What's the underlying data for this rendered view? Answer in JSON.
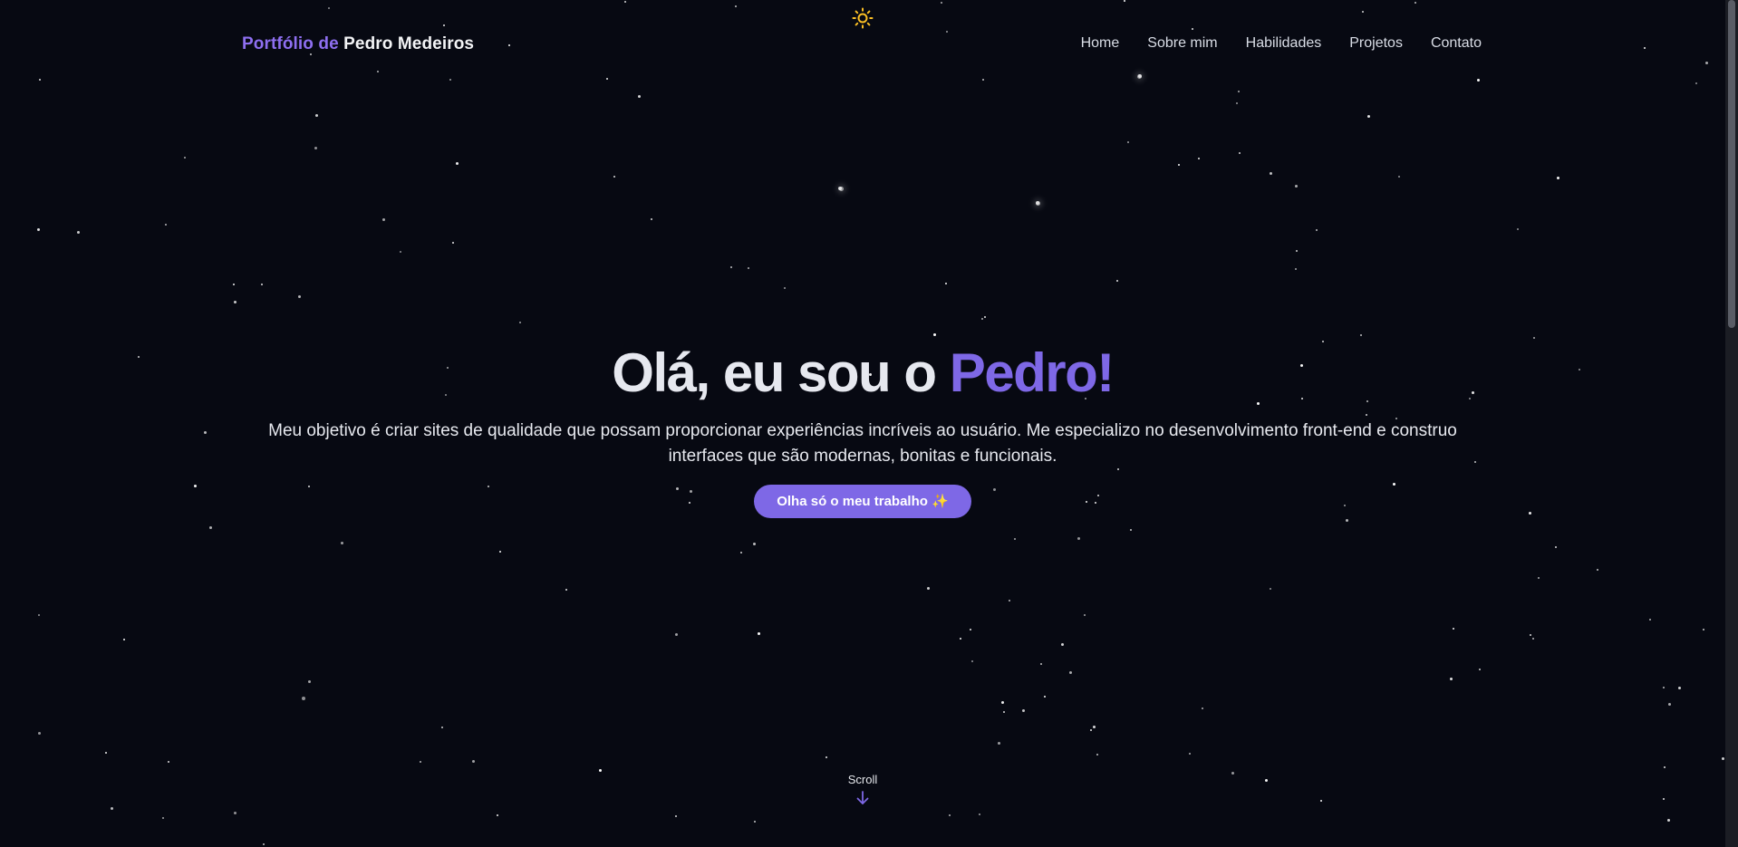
{
  "brand": {
    "prefix": "Portfólio de",
    "name": "Pedro Medeiros"
  },
  "theme_toggle": {
    "icon": "sun-icon",
    "color": "#fbbf24"
  },
  "nav": {
    "items": [
      {
        "label": "Home"
      },
      {
        "label": "Sobre mim"
      },
      {
        "label": "Habilidades"
      },
      {
        "label": "Projetos"
      },
      {
        "label": "Contato"
      }
    ]
  },
  "hero": {
    "title_prefix": "Olá, eu sou o",
    "title_name": "Pedro!",
    "description": "Meu objetivo é criar sites de qualidade que possam proporcionar experiências incríveis ao usuário. Me especializo no desenvolvimento front-end e construo interfaces que são modernas, bonitas e funcionais.",
    "cta_label": "Olha só o meu trabalho ✨"
  },
  "scroll": {
    "label": "Scroll",
    "icon": "arrow-down-icon"
  },
  "colors": {
    "background": "#070912",
    "accent": "#7e68e6",
    "text": "#e6e8ef"
  }
}
